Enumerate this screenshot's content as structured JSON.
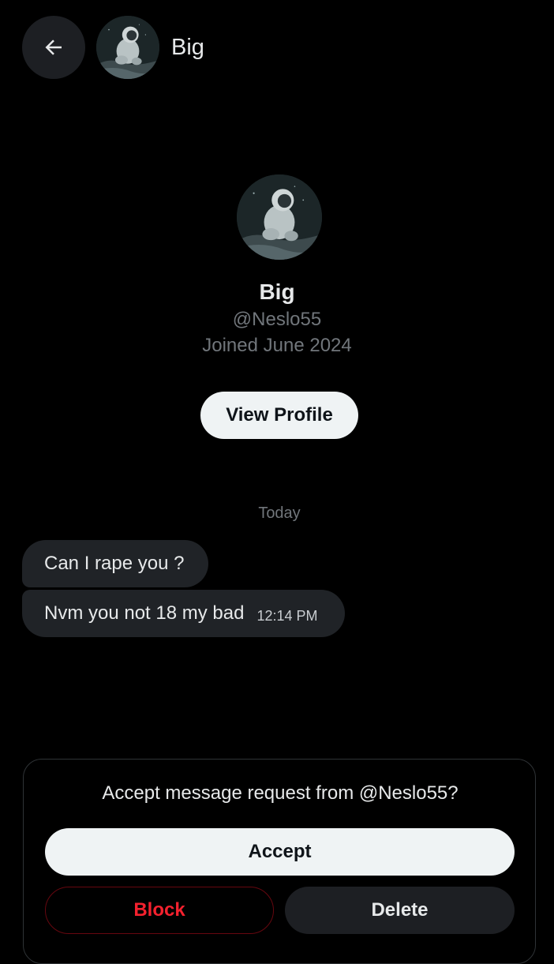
{
  "header": {
    "back_icon": "arrow-left-icon",
    "name": "Big"
  },
  "profile": {
    "name": "Big",
    "handle": "@Neslo55",
    "joined": "Joined June 2024",
    "view_profile_label": "View Profile"
  },
  "conversation": {
    "day_label": "Today",
    "messages": [
      {
        "text": "Can I rape you ?",
        "time": ""
      },
      {
        "text": "Nvm you not 18 my bad",
        "time": "12:14 PM"
      }
    ]
  },
  "request": {
    "prompt": "Accept message request from @Neslo55?",
    "accept_label": "Accept",
    "block_label": "Block",
    "delete_label": "Delete"
  },
  "colors": {
    "background": "#000000",
    "bubble": "#202327",
    "muted_text": "#71767b",
    "primary_button": "#eff3f4",
    "danger": "#f4212e"
  }
}
